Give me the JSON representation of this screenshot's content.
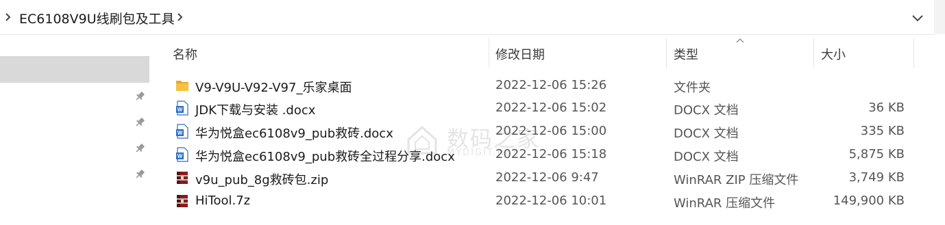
{
  "address": {
    "path": "EC6108V9U线刷包及工具"
  },
  "columns": {
    "name": "名称",
    "date": "修改日期",
    "type": "类型",
    "size": "大小"
  },
  "files": [
    {
      "name": "V9-V9U-V92-V97_乐家桌面",
      "date": "2022-12-06 15:26",
      "type": "文件夹",
      "size": "",
      "icon": "folder-icon"
    },
    {
      "name": "JDK下载与安装 .docx",
      "date": "2022-12-06 15:02",
      "type": "DOCX 文档",
      "size": "36 KB",
      "icon": "word-document-icon"
    },
    {
      "name": "华为悦盒ec6108v9_pub救砖.docx",
      "date": "2022-12-06 15:00",
      "type": "DOCX 文档",
      "size": "335 KB",
      "icon": "word-document-icon"
    },
    {
      "name": "华为悦盒ec6108v9_pub救砖全过程分享.docx",
      "date": "2022-12-06 15:18",
      "type": "DOCX 文档",
      "size": "5,875 KB",
      "icon": "word-document-icon"
    },
    {
      "name": "v9u_pub_8g救砖包.zip",
      "date": "2022-12-06 9:47",
      "type": "WinRAR ZIP 压缩文件",
      "size": "3,749 KB",
      "icon": "winrar-archive-icon"
    },
    {
      "name": "HiTool.7z",
      "date": "2022-12-06 10:01",
      "type": "WinRAR 压缩文件",
      "size": "149,900 KB",
      "icon": "winrar-archive-icon"
    }
  ],
  "watermark": {
    "cn": "数码之家",
    "en": "MYDIGIT.NET"
  },
  "colors": {
    "folder": "#f5c242",
    "word": "#2b6cc4",
    "winrar": "#8b1a1a",
    "selection": "#d9d9d9"
  }
}
